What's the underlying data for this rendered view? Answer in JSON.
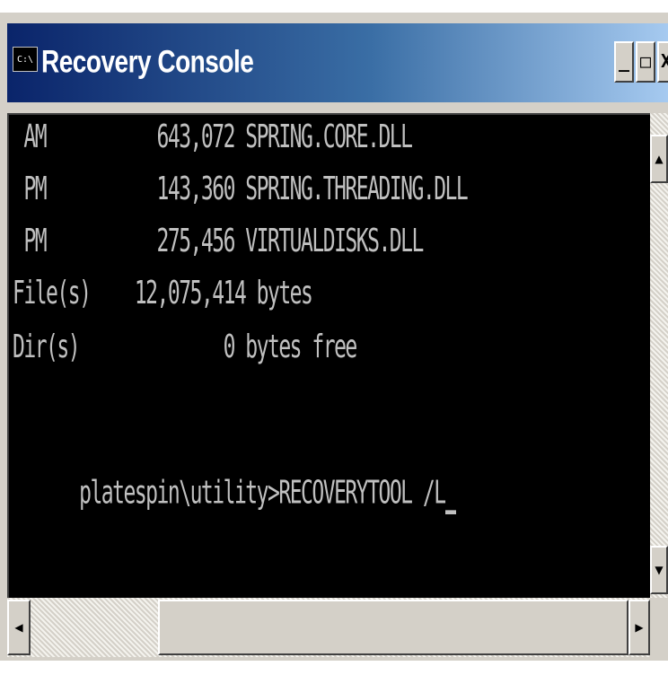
{
  "window": {
    "title": "Recovery Console",
    "icon_text": "C:\\",
    "controls": {
      "minimize": "_",
      "maximize": "□",
      "close": "X"
    }
  },
  "console": {
    "lines": [
      " AM          643,072 SPRING.CORE.DLL",
      " PM          143,360 SPRING.THREADING.DLL",
      " PM          275,456 VIRTUALDISKS.DLL",
      "File(s)    12,075,414 bytes",
      "Dir(s)             0 bytes free",
      "",
      "platespin\\utility>RECOVERYTOOL /L"
    ],
    "text_color": "#c0c0c0",
    "background": "#000000"
  },
  "scrollbars": {
    "vertical": {
      "up_icon": "▲",
      "down_icon": "▼"
    },
    "horizontal": {
      "left_icon": "◀",
      "right_icon": "▶"
    }
  }
}
